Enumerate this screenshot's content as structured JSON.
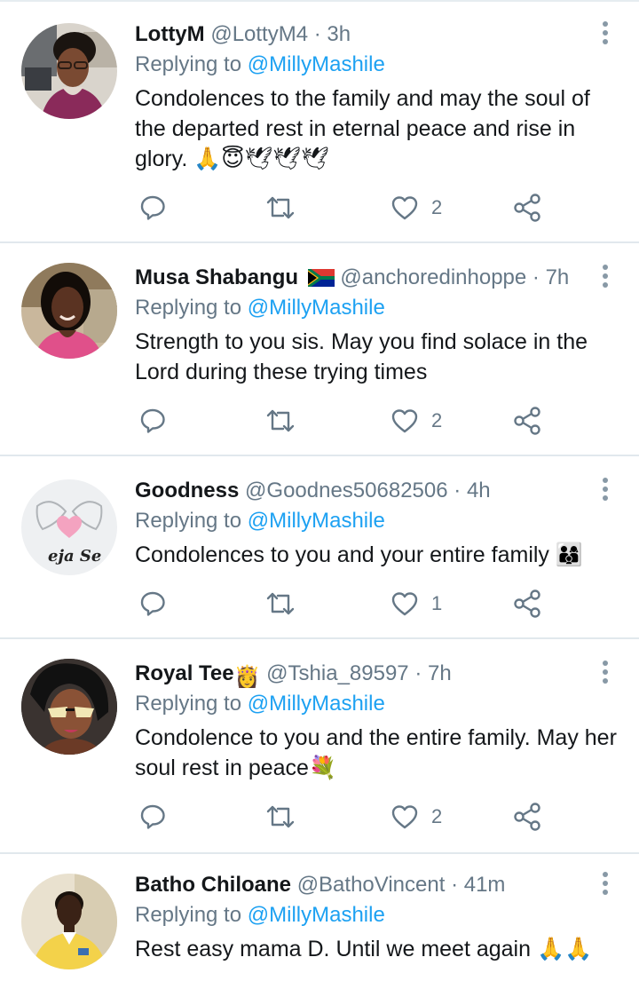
{
  "replying_label": "Replying to",
  "tweets": [
    {
      "name": "LottyM",
      "handle": "@LottyM4",
      "time": "3h",
      "reply_to": "@MillyMashile",
      "text": "Condolences to the family and may the soul of the departed rest in eternal peace and rise in glory. 🙏😇🕊🕊🕊",
      "likes": "2",
      "avatar_icon": "woman-glasses-avatar"
    },
    {
      "name": "Musa Shabangu",
      "flag": "south-africa-flag",
      "handle": "@anchoredinhoppe",
      "time": "7h",
      "reply_to": "@MillyMashile",
      "text": "Strength to you sis. May you find solace in the Lord during these trying times",
      "likes": "2",
      "avatar_icon": "woman-smiling-avatar"
    },
    {
      "name": "Goodness",
      "handle": "@Goodnes50682506",
      "time": "4h",
      "reply_to": "@MillyMashile",
      "text": "Condolences to you and your entire family 👨‍👩‍👦",
      "likes": "1",
      "avatar_icon": "heart-hands-avatar",
      "avatar_text": "eja Se"
    },
    {
      "name": "Royal Tee",
      "name_emoji": "👸",
      "handle": "@Tshia_89597",
      "time": "7h",
      "reply_to": "@MillyMashile",
      "text": "Condolence to you and the entire family. May her soul rest in peace💐",
      "likes": "2",
      "avatar_icon": "illustrated-woman-sunglasses-avatar"
    },
    {
      "name": "Batho Chiloane",
      "handle": "@BathoVincent",
      "time": "41m",
      "reply_to": "@MillyMashile",
      "text": "Rest easy mama D. Until we meet again 🙏🙏",
      "avatar_icon": "man-yellow-shirt-avatar"
    }
  ],
  "colors": {
    "text": "#14171a",
    "secondary": "#657786",
    "link": "#1da1f2",
    "divider": "#e1e8ed"
  }
}
